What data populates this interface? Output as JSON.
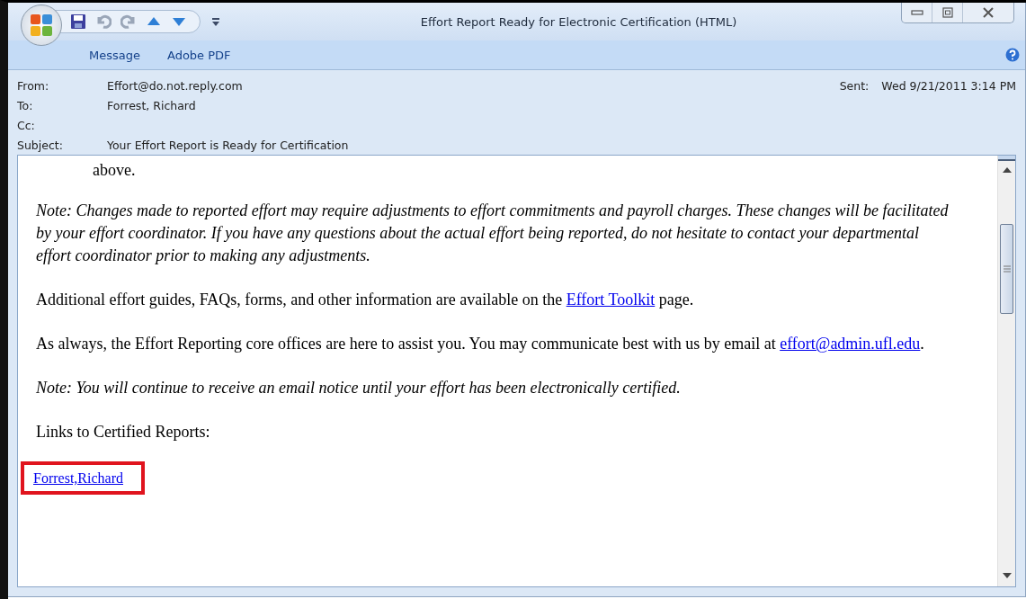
{
  "window": {
    "title": "Effort Report Ready for Electronic Certification  (HTML)"
  },
  "ribbon": {
    "tabs": [
      "Message",
      "Adobe PDF"
    ]
  },
  "header": {
    "fields": [
      {
        "label": "From:",
        "value": "Effort@do.not.reply.com"
      },
      {
        "label": "To:",
        "value": "Forrest, Richard"
      },
      {
        "label": "Cc:"
      },
      {
        "label": "Subject:",
        "value": "Your Effort Report is Ready for Certification"
      }
    ],
    "sent": {
      "label": "Sent:",
      "value": "Wed 9/21/2011 3:14 PM"
    }
  },
  "body": {
    "paragraphs": [
      {
        "kind": "continuation",
        "segments": [
          {
            "text": "above."
          }
        ]
      },
      {
        "kind": "note",
        "segments": [
          {
            "text": "Note: Changes made to reported effort may require adjustments to effort commitments and payroll charges. These changes will be facilitated by your effort coordinator. If you have any questions about the actual effort being reported, do not hesitate to contact your departmental effort coordinator prior to making any adjustments."
          }
        ]
      },
      {
        "kind": "plain",
        "segments": [
          {
            "text": "Additional effort guides, FAQs, forms, and other information are available on the "
          },
          {
            "link": "Effort Toolkit"
          },
          {
            "text": " page."
          }
        ]
      },
      {
        "kind": "plain",
        "segments": [
          {
            "text": "As always, the Effort Reporting core offices are here to assist you. You may communicate best with us by email at "
          },
          {
            "link": "effort@admin.ufl.edu"
          },
          {
            "text": "."
          }
        ]
      },
      {
        "kind": "note",
        "segments": [
          {
            "text": "Note: You will continue to receive an email notice until your effort has been electronically certified."
          }
        ]
      },
      {
        "kind": "plain",
        "segments": [
          {
            "text": "Links to Certified Reports:"
          }
        ]
      },
      {
        "kind": "link",
        "segments": [
          {
            "link": "Forrest,Richard"
          }
        ],
        "highlighted": true
      }
    ]
  }
}
